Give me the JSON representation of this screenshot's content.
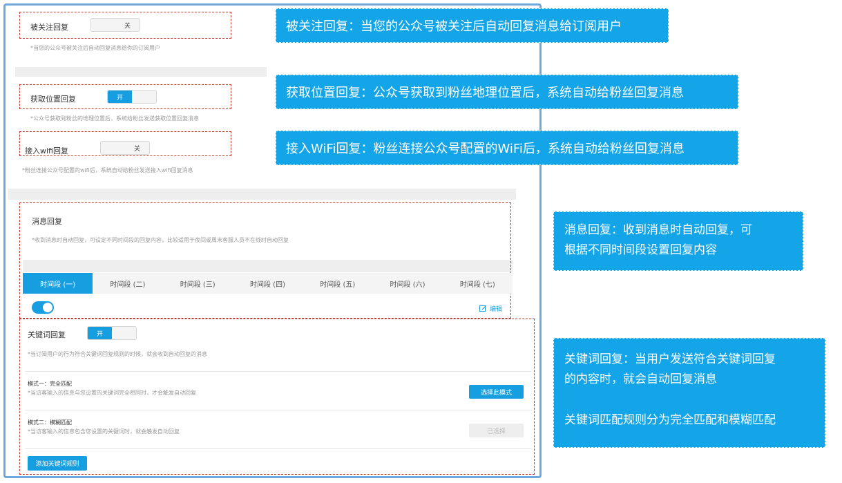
{
  "follow_reply": {
    "label": "被关注回复",
    "toggle_state": "关",
    "desc": "*当您的公众号被关注后自动回复消息给你的订阅用户"
  },
  "location_reply": {
    "label": "获取位置回复",
    "toggle_state": "开",
    "desc": "*公众号获取到粉丝的地理位置后，系统给粉丝发送获取位置回复消息"
  },
  "wifi_reply": {
    "label": "接入wifi回复",
    "toggle_state": "关",
    "desc": "*粉丝连接公众号配置的wifi后，系统自动给粉丝发送接入wifi回复消息"
  },
  "message_reply": {
    "label": "消息回复",
    "desc": "*收到消息时自动回复，可设定不同时间段的回复内容，比较适用于夜间或周末客服人员不在线时自动回复",
    "tabs": [
      "时间段 (一)",
      "时间段 (二)",
      "时间段 (三)",
      "时间段 (四)",
      "时间段 (五)",
      "时间段 (六)",
      "时间段 (七)"
    ],
    "active_tab": 0,
    "edit_label": "编辑",
    "switch_on": true
  },
  "keyword_reply": {
    "label": "关键词回复",
    "toggle_state": "开",
    "desc": "*当订阅用户的行为符合关键词回复规则的时候，就会收到自动回复的消息",
    "mode1": {
      "title": "模式一：完全匹配",
      "desc": "*当访客输入的信息与您设置的关键词完全相同时，才会触发自动回复",
      "button": "选择此模式"
    },
    "mode2": {
      "title": "模式二：模糊匹配",
      "desc": "*当访客输入的信息包含您设置的关键词时，就会触发自动回复",
      "button": "已选择"
    },
    "add_button": "添加关键词规则"
  },
  "callouts": {
    "follow": "被关注回复：当您的公众号被关注后自动回复消息给订阅用户",
    "location": "获取位置回复：公众号获取到粉丝地理位置后，系统自动给粉丝回复消息",
    "wifi": "接入WiFi回复：粉丝连接公众号配置的WiFi后，系统自动给粉丝回复消息",
    "message_line1": "消息回复：收到消息时自动回复，可",
    "message_line2": "根据不同时间段设置回复内容",
    "keyword_line1": "关键词回复：当用户发送符合关键词回复",
    "keyword_line2": "的内容时，就会自动回复消息",
    "keyword_line3": "关键词匹配规则分为完全匹配和模糊匹配"
  },
  "colors": {
    "accent": "#169ee0",
    "callout_bg": "#13a5e8",
    "dashed_border": "#c0392b",
    "frame": "#6fa8dc"
  }
}
